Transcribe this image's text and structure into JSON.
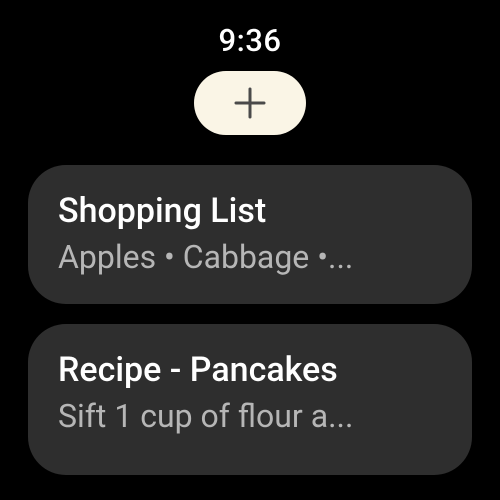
{
  "status": {
    "time": "9:36"
  },
  "add_button": {
    "icon_name": "plus-icon"
  },
  "notes": [
    {
      "title": "Shopping List",
      "subtitle": "Apples • Cabbage •..."
    },
    {
      "title": "Recipe - Pancakes",
      "subtitle": "Sift 1 cup of flour a..."
    }
  ]
}
